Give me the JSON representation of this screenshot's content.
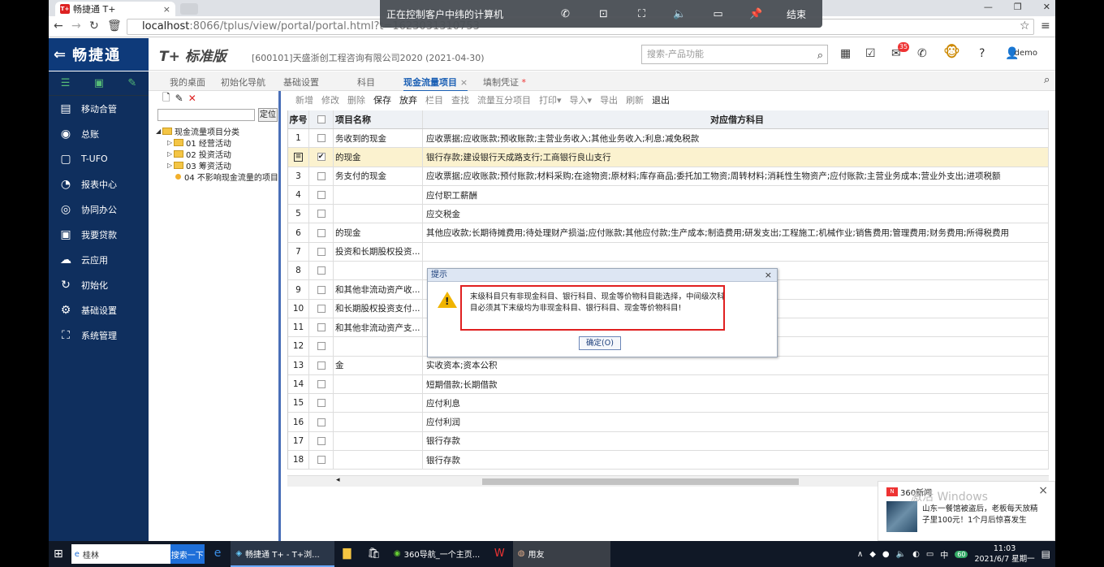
{
  "browser": {
    "tab_title": "畅捷通 T+",
    "tab_logo": "T+",
    "tab_close": "×",
    "url_host": "localhost",
    "url_rest": ":8066/tplus/view/portal/portal.html?t=1623031310753"
  },
  "remote": {
    "title": "正在控制客户中纬的计算机",
    "end": "结束",
    "icons": [
      "phone-icon",
      "ratio-icon",
      "fullscreen-icon",
      "speaker-icon",
      "hd-icon",
      "pin-icon"
    ]
  },
  "app": {
    "brand": "畅捷通",
    "product": "T+ 标准版",
    "company": "[600101]天盛浙创工程咨询有限公司2020  (2021-04-30)",
    "search_placeholder": "搜索-产品功能",
    "badge": "35",
    "user": "demo"
  },
  "sidebar": {
    "items": [
      {
        "label": "移动合管",
        "icon": "device-icon"
      },
      {
        "label": "总账",
        "icon": "ledger-icon"
      },
      {
        "label": "T-UFO",
        "icon": "ufo-icon"
      },
      {
        "label": "报表中心",
        "icon": "report-icon"
      },
      {
        "label": "协同办公",
        "icon": "collab-icon"
      },
      {
        "label": "我要贷款",
        "icon": "loan-icon"
      },
      {
        "label": "云应用",
        "icon": "cloud-icon"
      },
      {
        "label": "初始化",
        "icon": "init-icon"
      },
      {
        "label": "基础设置",
        "icon": "settings-icon"
      },
      {
        "label": "系统管理",
        "icon": "system-icon"
      }
    ]
  },
  "worktabs": {
    "tabs": [
      "我的桌面",
      "初始化导航",
      "基础设置",
      "科目",
      "现金流量项目",
      "填制凭证"
    ],
    "active_close": "×",
    "modified_mark": "*"
  },
  "tree": {
    "locate": "定位",
    "root": "现金流量项目分类",
    "children": [
      "01 经营活动",
      "02 投资活动",
      "03 筹资活动",
      "04 不影响现金流量的项目"
    ]
  },
  "toolbar": {
    "buttons": [
      {
        "label": "新增",
        "enabled": false
      },
      {
        "label": "修改",
        "enabled": false
      },
      {
        "label": "删除",
        "enabled": false
      },
      {
        "label": "保存",
        "enabled": true
      },
      {
        "label": "放弃",
        "enabled": true
      },
      {
        "label": "栏目",
        "enabled": false
      },
      {
        "label": "查找",
        "enabled": false
      },
      {
        "label": "流量互分项目",
        "enabled": false
      },
      {
        "label": "打印",
        "enabled": false
      },
      {
        "label": "导入",
        "enabled": false
      },
      {
        "label": "导出",
        "enabled": false
      },
      {
        "label": "刷新",
        "enabled": false
      },
      {
        "label": "退出",
        "enabled": true
      }
    ],
    "dropdown_marker": "▾"
  },
  "grid": {
    "headers": {
      "seq": "序号",
      "name": "项目名称",
      "account": "对应借方科目"
    },
    "rows": [
      {
        "seq": "1",
        "checked": false,
        "name": "务收到的现金",
        "account": "应收票据;应收账款;预收账款;主营业务收入;其他业务收入;利息;减免税款"
      },
      {
        "seq": "",
        "checked": true,
        "name": "的现金",
        "account": "银行存款;建设银行天成路支行;工商银行良山支行",
        "selected": true
      },
      {
        "seq": "3",
        "checked": false,
        "name": "务支付的现金",
        "account": "应收票据;应收账款;预付账款;材料采购;在途物资;原材料;库存商品;委托加工物资;周转材料;消耗性生物资产;应付账款;主营业务成本;营业外支出;进项税额"
      },
      {
        "seq": "4",
        "checked": false,
        "name": "",
        "account": "应付职工薪酬"
      },
      {
        "seq": "5",
        "checked": false,
        "name": "",
        "account": "应交税金"
      },
      {
        "seq": "6",
        "checked": false,
        "name": "的现金",
        "account": "其他应收款;长期待摊费用;待处理财产损溢;应付账款;其他应付款;生产成本;制造费用;研发支出;工程施工;机械作业;销售费用;管理费用;财务费用;所得税费用"
      },
      {
        "seq": "7",
        "checked": false,
        "name": "投资和长期股权投资...",
        "account": ""
      },
      {
        "seq": "8",
        "checked": false,
        "name": "",
        "account": ""
      },
      {
        "seq": "9",
        "checked": false,
        "name": "和其他非流动资产收...",
        "account": ""
      },
      {
        "seq": "10",
        "checked": false,
        "name": "和长期股权投资支付...",
        "account": ""
      },
      {
        "seq": "11",
        "checked": false,
        "name": "和其他非流动资产支...",
        "account": ""
      },
      {
        "seq": "12",
        "checked": false,
        "name": "",
        "account": ""
      },
      {
        "seq": "13",
        "checked": false,
        "name": "金",
        "account": "实收资本;资本公积"
      },
      {
        "seq": "14",
        "checked": false,
        "name": "",
        "account": "短期借款;长期借款"
      },
      {
        "seq": "15",
        "checked": false,
        "name": "",
        "account": "应付利息"
      },
      {
        "seq": "16",
        "checked": false,
        "name": "",
        "account": "应付利润"
      },
      {
        "seq": "17",
        "checked": false,
        "name": "",
        "account": "银行存款"
      },
      {
        "seq": "18",
        "checked": false,
        "name": "",
        "account": "银行存款"
      }
    ],
    "scroll_left": "◂"
  },
  "dialog": {
    "title": "提示",
    "close": "×",
    "message": "末级科目只有非现金科目、银行科目、现金等价物科目能选择，中间级次科目必须其下末级均为非现金科目、银行科目、现金等价物科目!",
    "ok": "确定(O)"
  },
  "notification": {
    "source": "360新闻",
    "watermark": "激活 Windows",
    "text": "山东一餐馆被盗后，老板每天放精子里100元！1个月后惊喜发生",
    "close": "×"
  },
  "taskbar": {
    "search_text": "桂林",
    "search_button": "搜索一下",
    "apps": [
      {
        "label": "畅捷通 T+ - T+浏...",
        "active": true
      },
      {
        "label": "",
        "active": false
      },
      {
        "label": "",
        "active": false
      },
      {
        "label": "360导航_一个主页...",
        "active": false
      },
      {
        "label": "",
        "active": false
      },
      {
        "label": "用友",
        "active": false
      }
    ],
    "ime": "中",
    "battery": "60",
    "time": "11:03",
    "date": "2021/6/7 星期一"
  }
}
